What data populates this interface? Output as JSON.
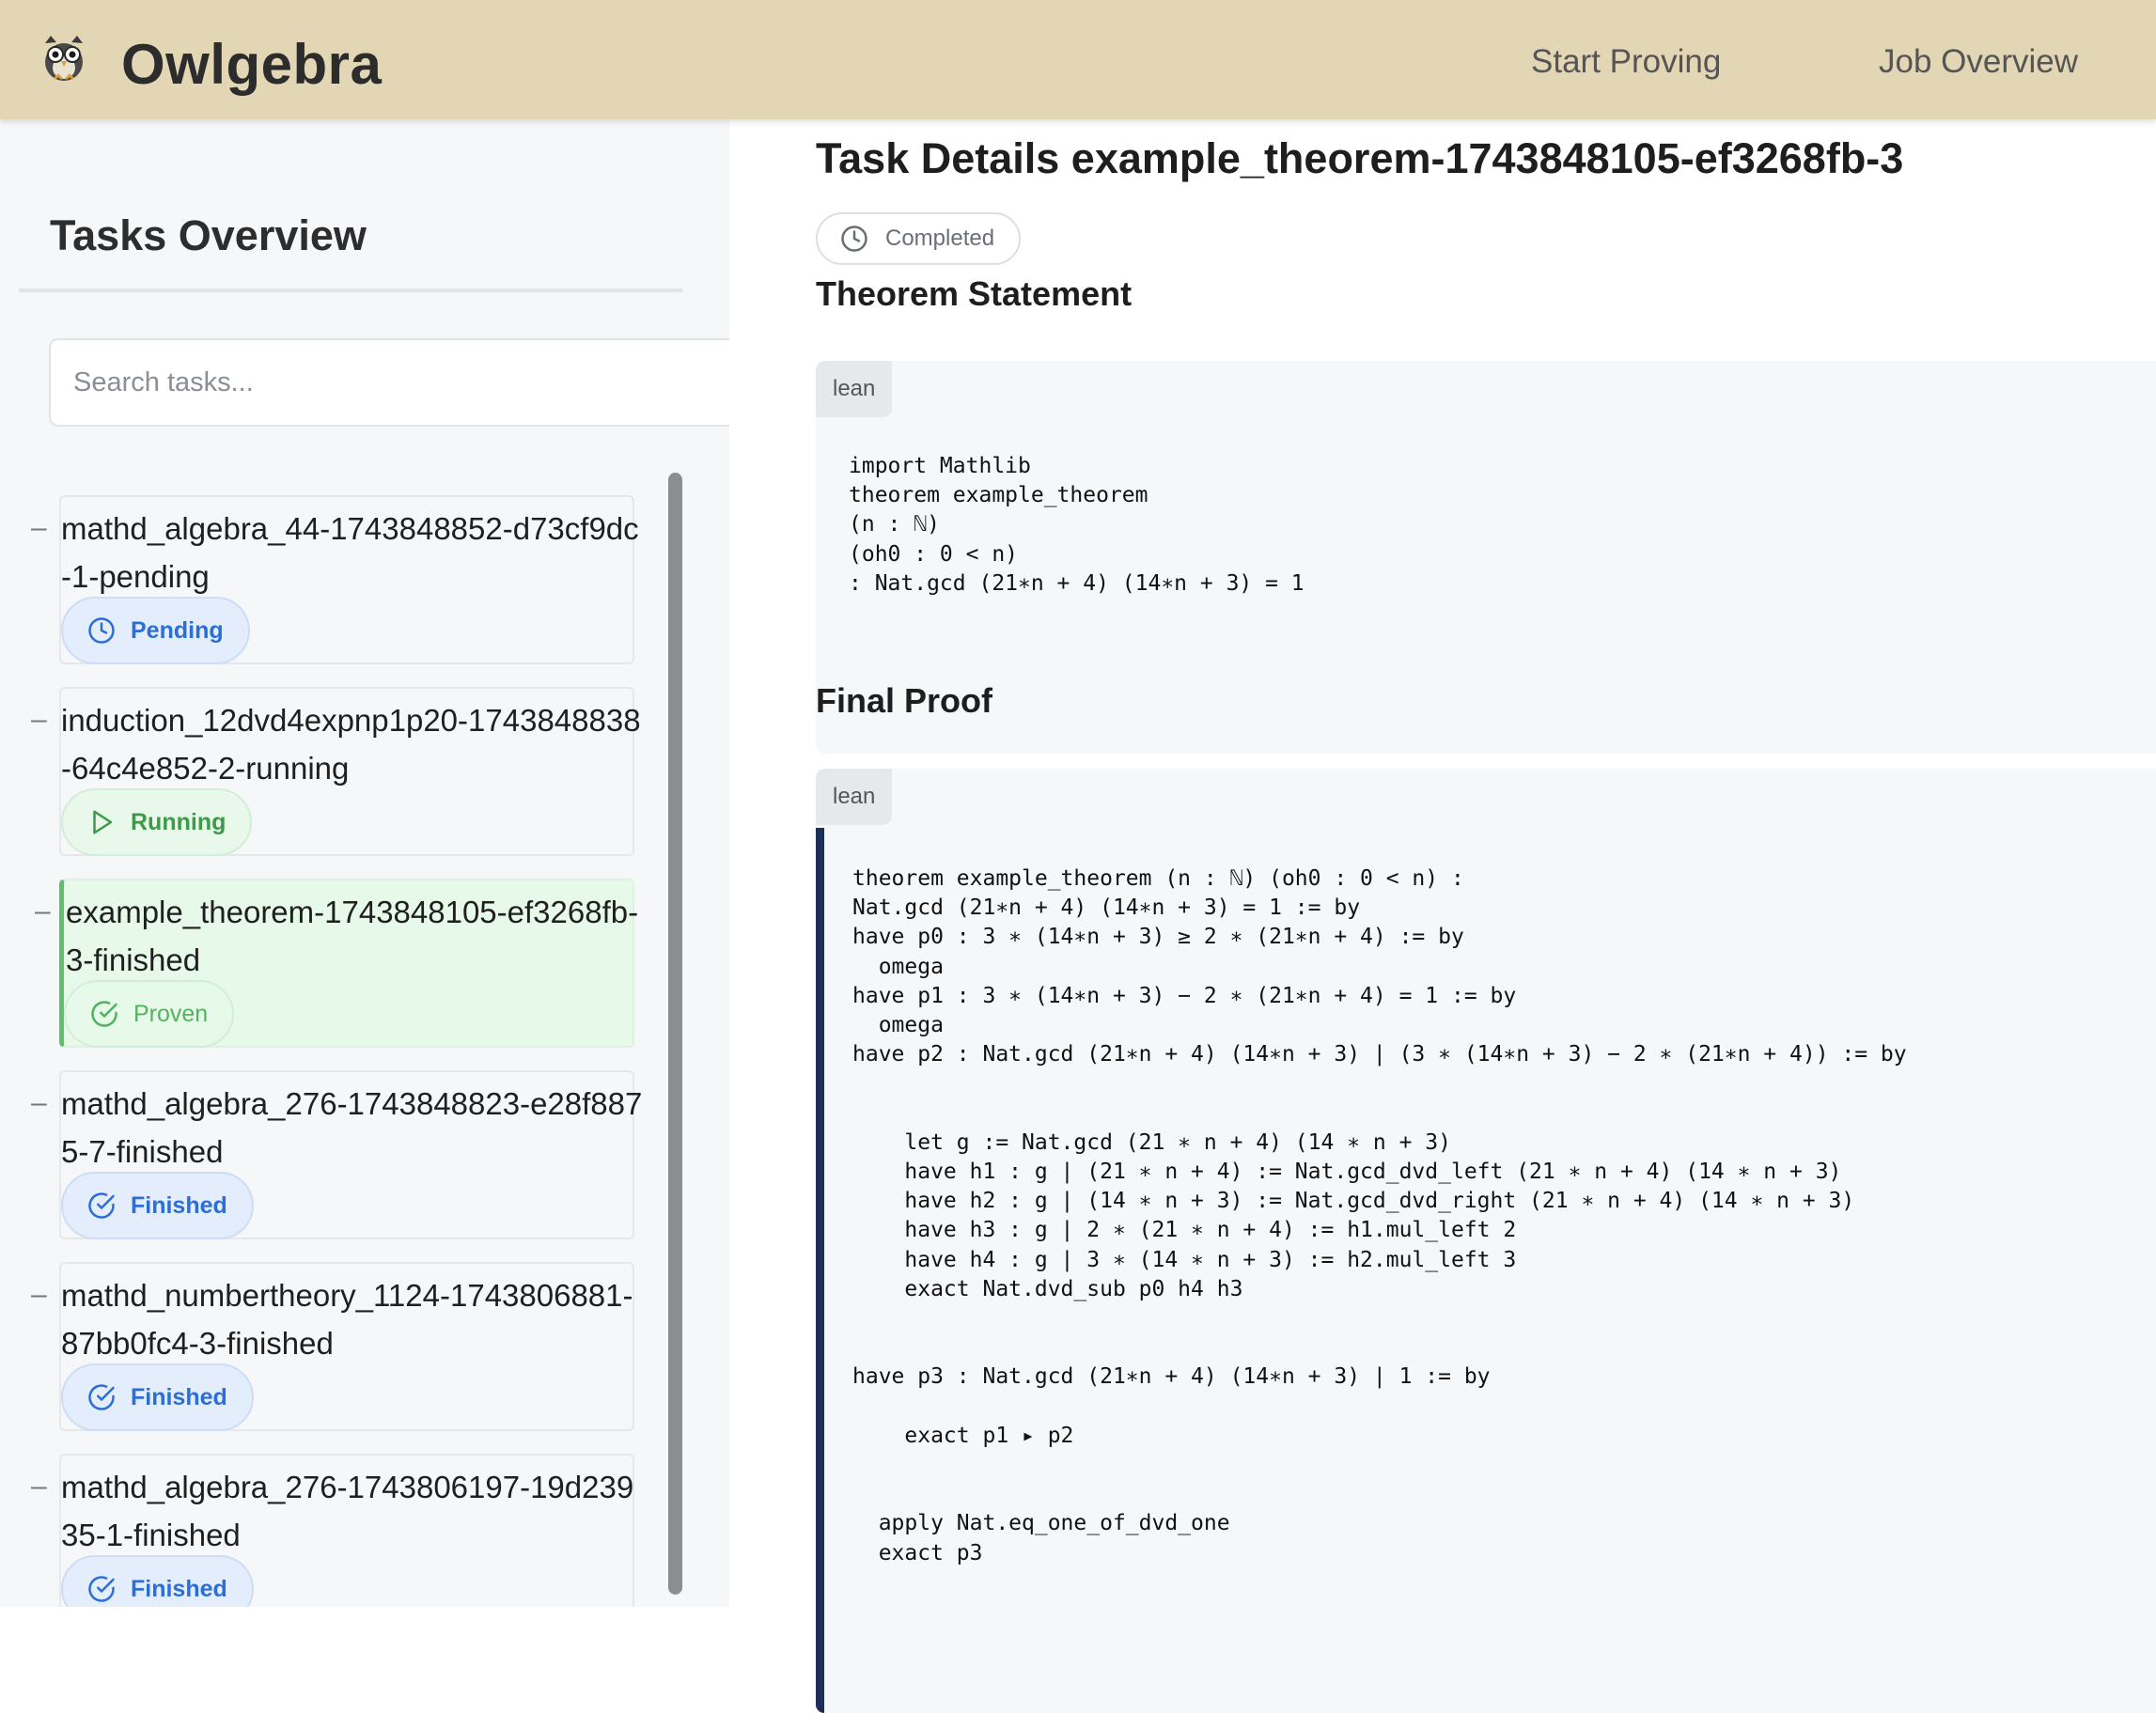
{
  "header": {
    "app_title": "Owlgebra",
    "nav": [
      "Start Proving",
      "Job Overview"
    ]
  },
  "sidebar": {
    "title": "Tasks Overview",
    "search_placeholder": "Search tasks...",
    "tasks": [
      {
        "name": "mathd_algebra_44-1743848852-d73cf9dc-1-pending",
        "status": "Pending",
        "status_icon": "clock-icon"
      },
      {
        "name": "induction_12dvd4expnp1p20-1743848838-64c4e852-2-running",
        "status": "Running",
        "status_icon": "play-icon"
      },
      {
        "name": "example_theorem-1743848105-ef3268fb-3-finished",
        "status": "Proven",
        "status_icon": "check-circle-icon",
        "selected": true
      },
      {
        "name": "mathd_algebra_276-1743848823-e28f8875-7-finished",
        "status": "Finished",
        "status_icon": "check-circle-icon"
      },
      {
        "name": "mathd_numbertheory_1124-1743806881-87bb0fc4-3-finished",
        "status": "Finished",
        "status_icon": "check-circle-icon"
      },
      {
        "name": "mathd_algebra_276-1743806197-19d23935-1-finished",
        "status": "Finished",
        "status_icon": "check-circle-icon"
      }
    ]
  },
  "main": {
    "title": "Task Details example_theorem-1743848105-ef3268fb-3",
    "status": "Completed",
    "theorem_heading": "Theorem Statement",
    "theorem_lang": "lean",
    "theorem_code": "import Mathlib\ntheorem example_theorem\n(n : ℕ)\n(oh0 : 0 < n)\n: Nat.gcd (21∗n + 4) (14∗n + 3) = 1",
    "proof_heading": "Final Proof",
    "proof_lang": "lean",
    "proof_code": "theorem example_theorem (n : ℕ) (oh0 : 0 < n) :\nNat.gcd (21∗n + 4) (14∗n + 3) = 1 := by\nhave p0 : 3 ∗ (14∗n + 3) ≥ 2 ∗ (21∗n + 4) := by\n  omega\nhave p1 : 3 ∗ (14∗n + 3) − 2 ∗ (21∗n + 4) = 1 := by\n  omega\nhave p2 : Nat.gcd (21∗n + 4) (14∗n + 3) ∣ (3 ∗ (14∗n + 3) − 2 ∗ (21∗n + 4)) := by\n\n\n    let g := Nat.gcd (21 ∗ n + 4) (14 ∗ n + 3)\n    have h1 : g ∣ (21 ∗ n + 4) := Nat.gcd_dvd_left (21 ∗ n + 4) (14 ∗ n + 3)\n    have h2 : g ∣ (14 ∗ n + 3) := Nat.gcd_dvd_right (21 ∗ n + 4) (14 ∗ n + 3)\n    have h3 : g ∣ 2 ∗ (21 ∗ n + 4) := h1.mul_left 2\n    have h4 : g ∣ 3 ∗ (14 ∗ n + 3) := h2.mul_left 3\n    exact Nat.dvd_sub p0 h4 h3\n\n\nhave p3 : Nat.gcd (21∗n + 4) (14∗n + 3) ∣ 1 := by\n\n    exact p1 ▸ p2\n\n\n  apply Nat.eq_one_of_dvd_one\n  exact p3"
  },
  "colors": {
    "header_bg": "#e2d6b5",
    "active_task_bg": "#e7fae9",
    "active_task_accent": "#5fbf6a",
    "badge_blue": "#2c6ed5",
    "badge_green": "#3c9a48",
    "proof_accent": "#1c2d57"
  }
}
